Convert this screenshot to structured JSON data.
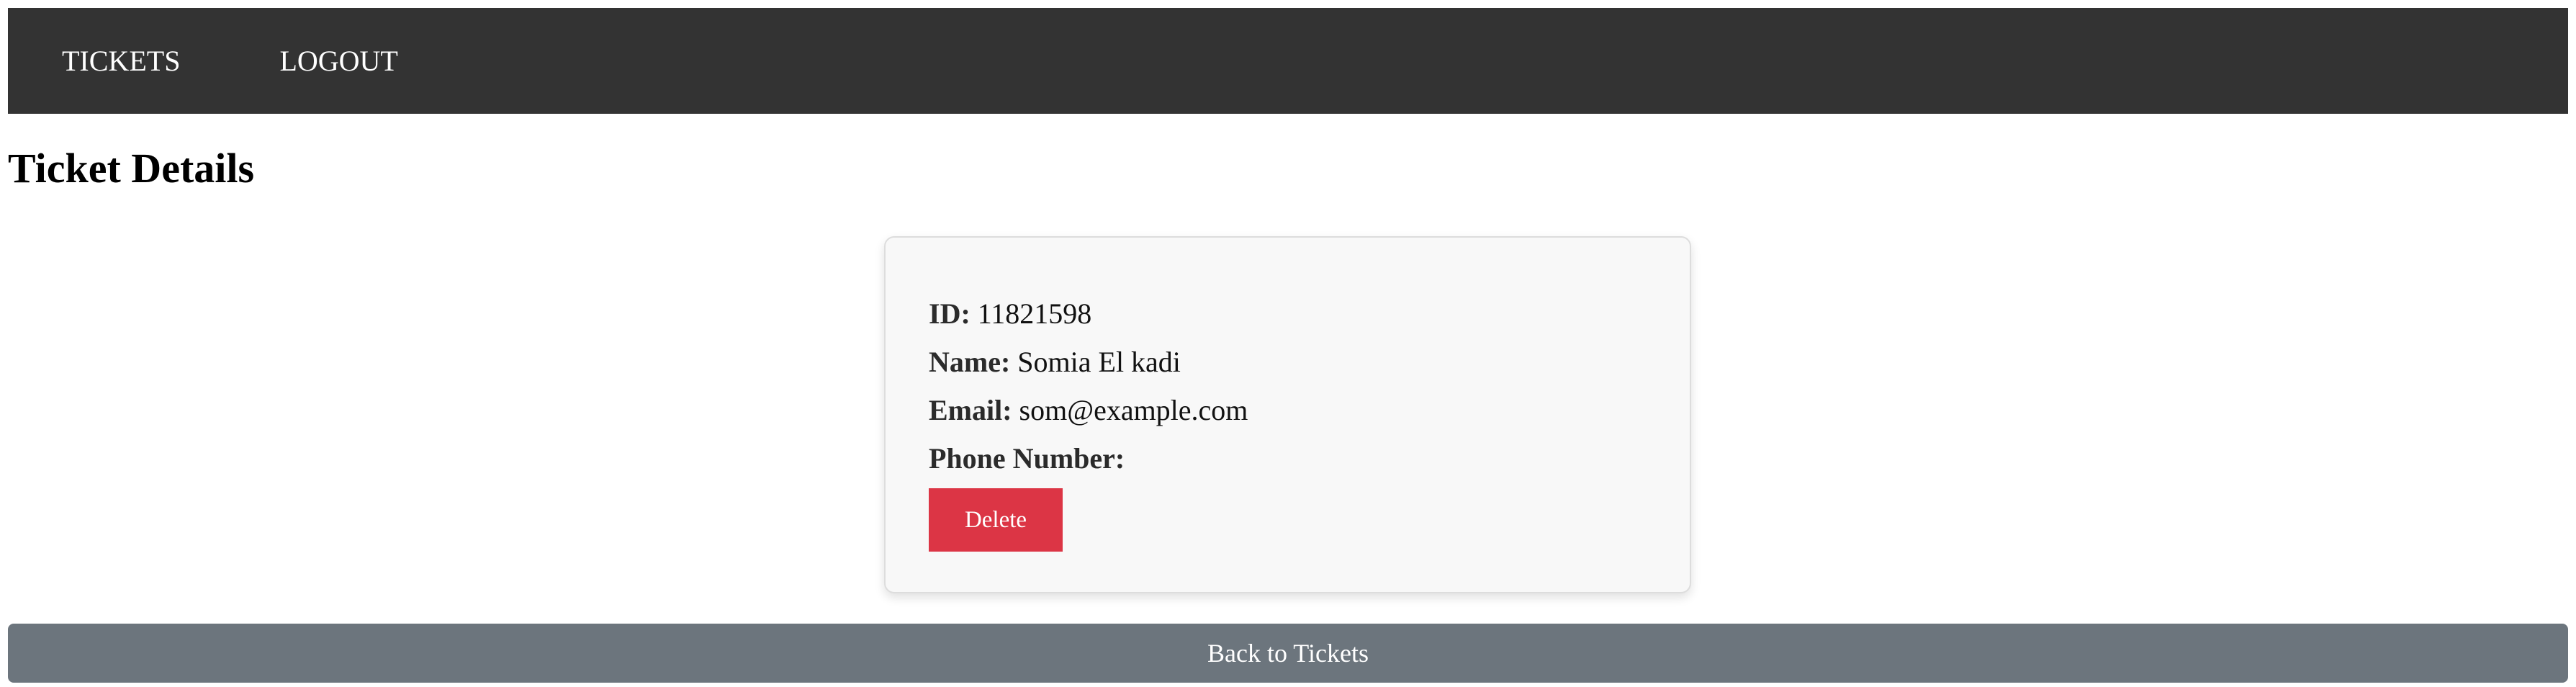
{
  "nav": {
    "tickets_label": "TICKETS",
    "logout_label": "LOGOUT"
  },
  "page_title": "Ticket Details",
  "ticket": {
    "id_label": "ID:",
    "id_value": "11821598",
    "name_label": "Name:",
    "name_value": "Somia El kadi",
    "email_label": "Email:",
    "email_value": "som@example.com",
    "phone_label": "Phone Number:",
    "phone_value": ""
  },
  "actions": {
    "delete_label": "Delete",
    "back_label": "Back to Tickets"
  },
  "colors": {
    "navbar": "#333333",
    "delete": "#dc3545",
    "back": "#6c757d",
    "card_bg": "#f8f8f8"
  }
}
